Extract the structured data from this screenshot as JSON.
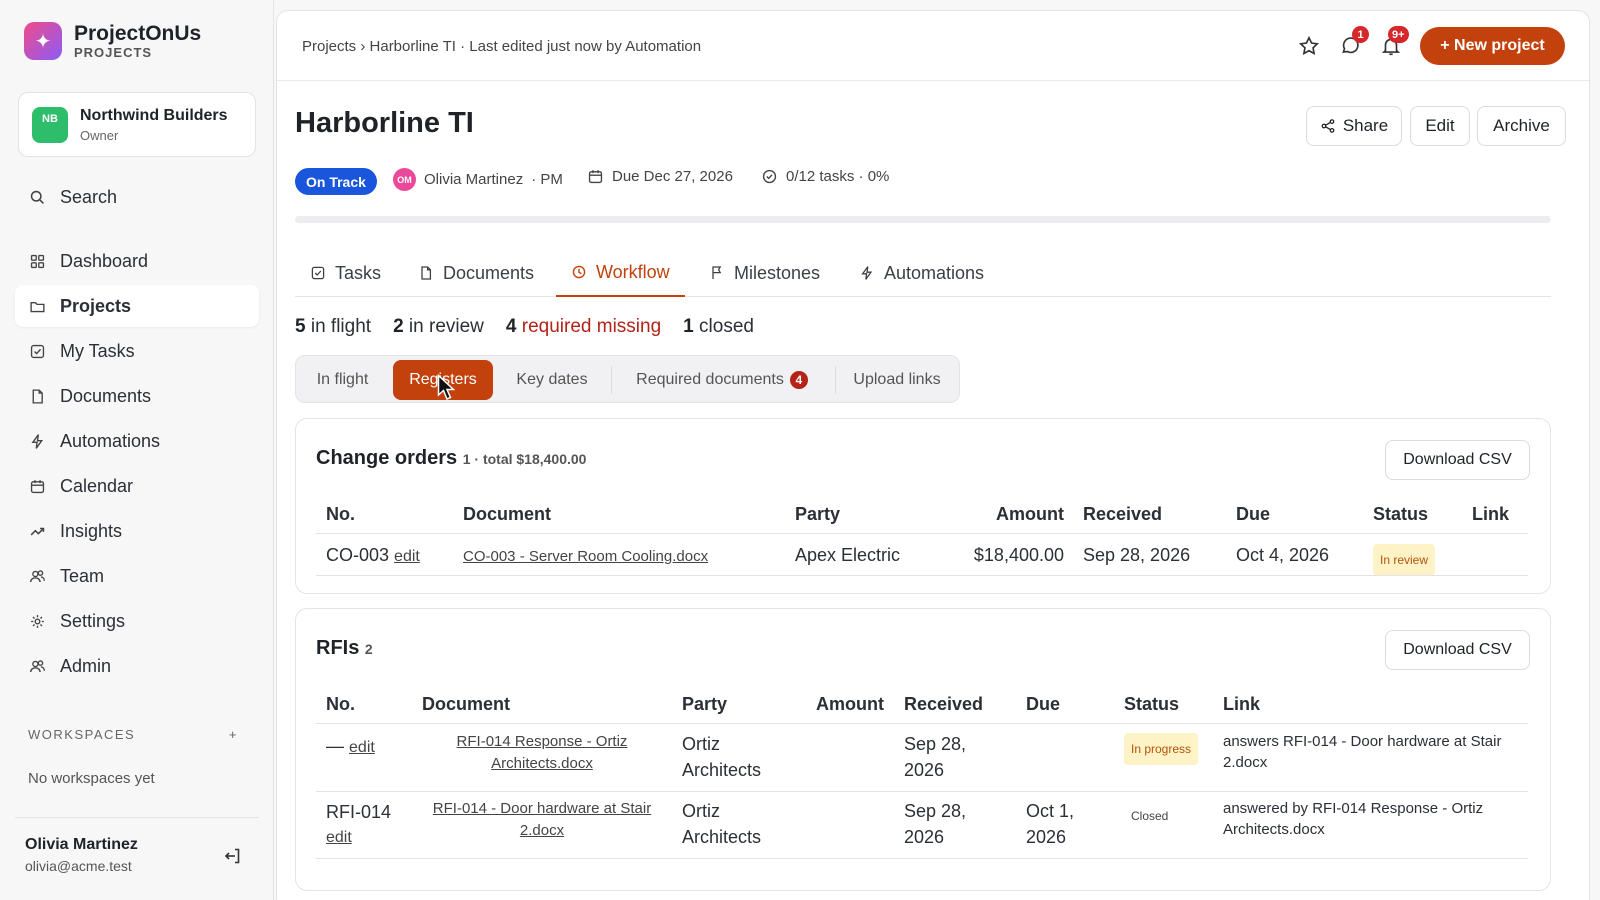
{
  "app": {
    "name": "ProjectOnUs",
    "section": "PROJECTS"
  },
  "org": {
    "initials": "NB",
    "name": "Northwind Builders",
    "role": "Owner"
  },
  "nav": [
    {
      "label": "Search",
      "icon": "search-icon"
    },
    {
      "label": "Dashboard",
      "icon": "grid-icon"
    },
    {
      "label": "Projects",
      "icon": "folder-icon",
      "active": true
    },
    {
      "label": "My Tasks",
      "icon": "checkbox-icon"
    },
    {
      "label": "Documents",
      "icon": "document-icon"
    },
    {
      "label": "Automations",
      "icon": "bolt-icon"
    },
    {
      "label": "Calendar",
      "icon": "calendar-icon"
    },
    {
      "label": "Insights",
      "icon": "trend-icon"
    },
    {
      "label": "Team",
      "icon": "users-icon"
    },
    {
      "label": "Settings",
      "icon": "gear-icon"
    },
    {
      "label": "Admin",
      "icon": "users-icon"
    }
  ],
  "workspaces": {
    "header": "WORKSPACES",
    "add": "+",
    "empty": "No workspaces yet"
  },
  "user": {
    "name": "Olivia Martinez",
    "email": "olivia@acme.test"
  },
  "topbar": {
    "breadcrumb": "Projects › Harborline TI · Last edited just now by Automation",
    "messages_badge": "1",
    "notifications_badge": "9+",
    "new_project": "+ New project"
  },
  "project": {
    "title": "Harborline TI",
    "status": "On Track",
    "pm_initials": "OM",
    "pm_name": "Olivia Martinez",
    "pm_role": "· PM",
    "due": "Due Dec 27, 2026",
    "tasks": "0/12 tasks · 0%",
    "progress_fraction": 0.0,
    "actions": {
      "share": "Share",
      "edit": "Edit",
      "archive": "Archive"
    }
  },
  "tabs": [
    {
      "label": "Tasks",
      "icon": "checkbox-icon"
    },
    {
      "label": "Documents",
      "icon": "document-icon"
    },
    {
      "label": "Workflow",
      "icon": "clock-icon",
      "active": true
    },
    {
      "label": "Milestones",
      "icon": "flag-icon"
    },
    {
      "label": "Automations",
      "icon": "bolt-icon"
    }
  ],
  "stats": {
    "in_flight_n": "5",
    "in_flight": "in flight",
    "in_review_n": "2",
    "in_review": "in review",
    "missing_n": "4",
    "missing": "required missing",
    "closed_n": "1",
    "closed": "closed"
  },
  "subtabs": {
    "in_flight": "In flight",
    "registers": "Registers",
    "key_dates": "Key dates",
    "required_docs": "Required documents",
    "required_docs_count": "4",
    "upload_links": "Upload links"
  },
  "change_orders": {
    "title": "Change orders",
    "summary": "1 · total $18,400.00",
    "download": "Download CSV",
    "columns": [
      "No.",
      "Document",
      "Party",
      "Amount",
      "Received",
      "Due",
      "Status",
      "Link"
    ],
    "rows": [
      {
        "no": "CO-003",
        "edit": "edit",
        "document": "CO-003 - Server Room Cooling.docx",
        "party": "Apex Electric",
        "amount": "$18,400.00",
        "received": "Sep 28, 2026",
        "due": "Oct 4, 2026",
        "status": "In review",
        "link": ""
      }
    ]
  },
  "rfis": {
    "title": "RFIs",
    "summary": "2",
    "download": "Download CSV",
    "columns": [
      "No.",
      "Document",
      "Party",
      "Amount",
      "Received",
      "Due",
      "Status",
      "Link"
    ],
    "rows": [
      {
        "no": "—",
        "edit": "edit",
        "document_line1": "RFI-014 Response - Ortiz",
        "document_line2": "Architects.docx",
        "party_line1": "Ortiz",
        "party_line2": "Architects",
        "received_line1": "Sep 28,",
        "received_line2": "2026",
        "due_line1": "",
        "due_line2": "",
        "status": "In progress",
        "link": "answers RFI-014 - Door hardware at Stair 2.docx"
      },
      {
        "no": "RFI-014",
        "edit": "edit",
        "document_line1": "RFI-014 - Door hardware at Stair",
        "document_line2": "2.docx",
        "party_line1": "Ortiz",
        "party_line2": "Architects",
        "received_line1": "Sep 28,",
        "received_line2": "2026",
        "due_line1": "Oct 1,",
        "due_line2": "2026",
        "status": "Closed",
        "link": "answered by RFI-014 Response - Ortiz Architects.docx"
      }
    ]
  },
  "colors": {
    "accent": "#c2410c",
    "status_blue": "#1a56db",
    "danger": "#b42318"
  }
}
